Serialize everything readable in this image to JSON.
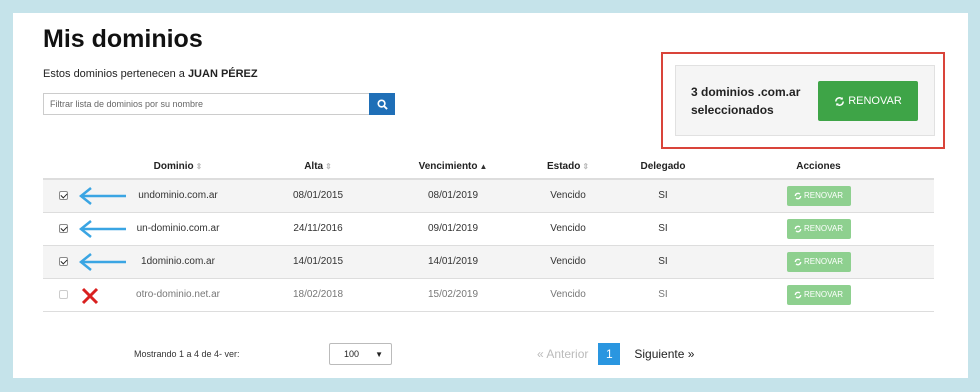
{
  "page": {
    "title": "Mis dominios"
  },
  "owner": {
    "prefix": "Estos dominios pertenecen a",
    "name": "JUAN PÉREZ"
  },
  "filter": {
    "placeholder": "Filtrar lista de dominios por su nombre",
    "search_icon": "search-icon"
  },
  "selection": {
    "summary": "3 dominios .com.ar seleccionados",
    "renew_label": "RENOVAR"
  },
  "table": {
    "columns": [
      "Dominio",
      "Alta",
      "Vencimiento",
      "Estado",
      "Delegado",
      "Acciones"
    ],
    "rows": [
      {
        "checked": true,
        "mark": "arrow",
        "domain": "undominio.com.ar",
        "alta": "08/01/2015",
        "vencimiento": "08/01/2019",
        "estado": "Vencido",
        "delegado": "SI",
        "action": "RENOVAR"
      },
      {
        "checked": true,
        "mark": "arrow",
        "domain": "un-dominio.com.ar",
        "alta": "24/11/2016",
        "vencimiento": "09/01/2019",
        "estado": "Vencido",
        "delegado": "SI",
        "action": "RENOVAR"
      },
      {
        "checked": true,
        "mark": "arrow",
        "domain": "1dominio.com.ar",
        "alta": "14/01/2015",
        "vencimiento": "14/01/2019",
        "estado": "Vencido",
        "delegado": "SI",
        "action": "RENOVAR"
      },
      {
        "checked": false,
        "mark": "cross",
        "domain": "otro-dominio.net.ar",
        "alta": "18/02/2018",
        "vencimiento": "15/02/2019",
        "estado": "Vencido",
        "delegado": "SI",
        "action": "RENOVAR"
      }
    ]
  },
  "footer": {
    "info": "Mostrando 1 a 4 de 4- ver:",
    "page_size": "100",
    "prev": "« Anterior",
    "current_page": "1",
    "next": "Siguiente »"
  },
  "colors": {
    "accent_green": "#3ea447",
    "arrow_blue": "#3aa5e3",
    "cross_red": "#d9201f",
    "callout_border": "#d9443a"
  }
}
